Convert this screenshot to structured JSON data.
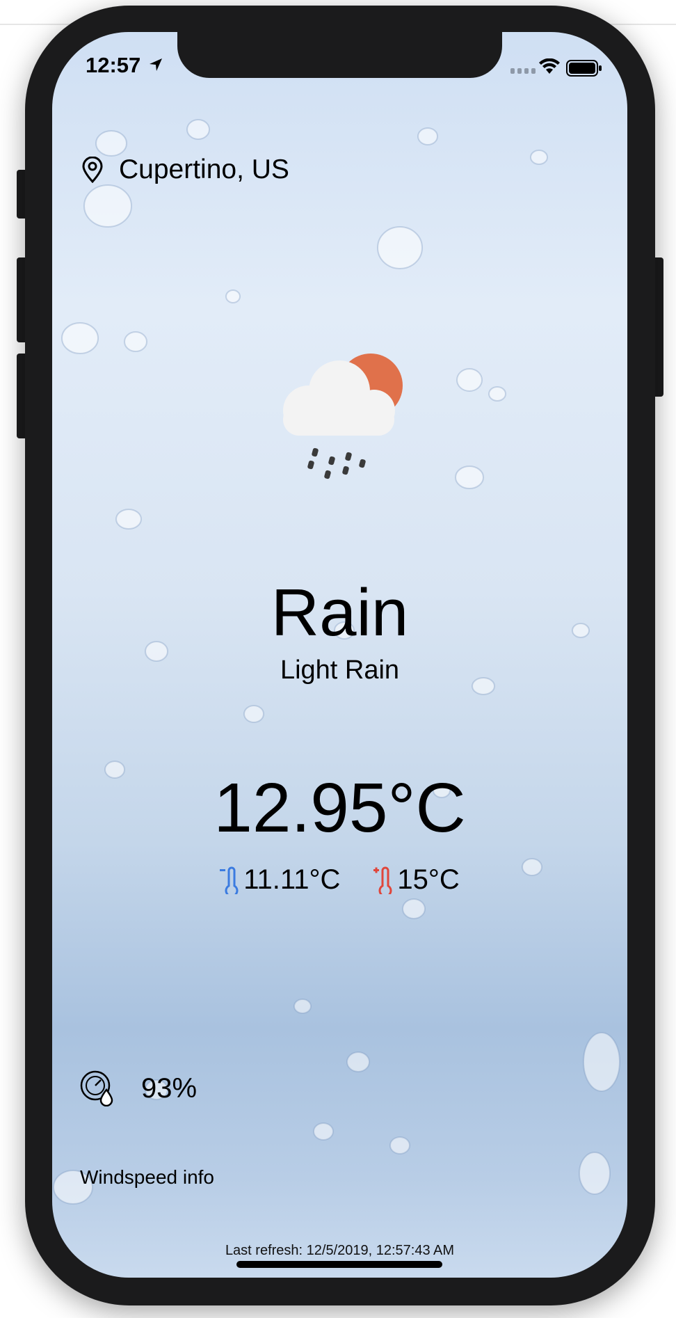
{
  "status_bar": {
    "time": "12:57"
  },
  "location": {
    "name": "Cupertino, US"
  },
  "weather": {
    "icon": "rain-cloud-sun-icon",
    "condition": "Rain",
    "description": "Light Rain",
    "temperature": "12.95°C",
    "min_temp": "11.11°C",
    "max_temp": "15°C",
    "humidity": "93%",
    "windspeed_label": "Windspeed info"
  },
  "footer": {
    "last_refresh": "Last refresh: 12/5/2019, 12:57:43 AM"
  },
  "colors": {
    "min_thermometer": "#3b7be0",
    "max_thermometer": "#e0463b",
    "sun": "#e0714b"
  }
}
